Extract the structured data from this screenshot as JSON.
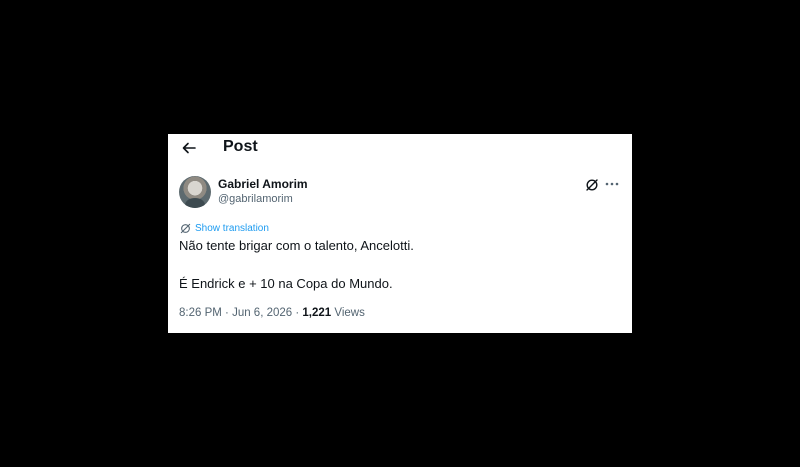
{
  "header": {
    "title": "Post"
  },
  "author": {
    "name": "Gabriel Amorim",
    "handle": "@gabrilamorim"
  },
  "translation": {
    "label": "Show translation"
  },
  "post": {
    "lines": [
      "Não tente brigar com o talento, Ancelotti.",
      "É Endrick e + 10 na Copa do Mundo."
    ]
  },
  "meta": {
    "time": "8:26 PM",
    "separator1": " · ",
    "date": "Jun 6, 2026",
    "separator2": " · ",
    "views_count": "1,221",
    "views_label": " Views"
  },
  "icons": {
    "back": "arrow-left-icon",
    "grok": "grok-icon",
    "more": "more-horizontal-icon",
    "translate": "globe-icon"
  },
  "colors": {
    "background": "#000000",
    "card": "#ffffff",
    "text": "#0f1419",
    "muted": "#536471",
    "link": "#1d9bf0"
  }
}
